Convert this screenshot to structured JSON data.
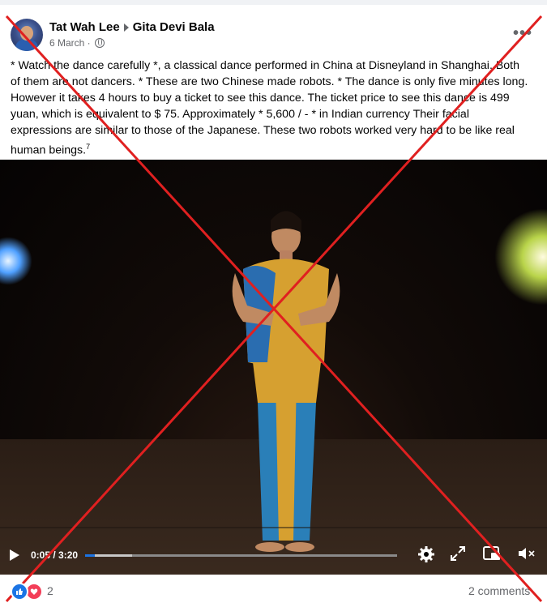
{
  "post": {
    "author": "Tat Wah Lee",
    "target": "Gita Devi Bala",
    "date": "6 March ·",
    "more_label": "•••",
    "text": "* Watch the dance carefully *, a classical dance performed in China at Disneyland in Shanghai. Both of them are not dancers. * These are two Chinese made robots. * The dance is only five minutes long. However it takes 4 hours to buy a ticket to see this dance. The ticket price to see this dance is 499 yuan, which is equivalent to $ 75. Approximately * 5,600 / - * in Indian currency Their facial expressions are similar to those of the Japanese. These two robots worked very hard to be like real human beings.",
    "footnote": "7"
  },
  "video": {
    "time": "0:05 / 3:20",
    "progress": 0.03,
    "buffered": 0.15
  },
  "footer": {
    "reaction_count": "2",
    "comments": "2 comments"
  },
  "icons": {
    "privacy": "globe-icon",
    "play": "play-icon",
    "settings": "gear-icon",
    "fullscreen": "expand-icon",
    "pip": "picture-in-picture-icon",
    "volume": "muted-speaker-icon",
    "like": "like-icon",
    "love": "love-icon"
  },
  "colors": {
    "accent": "#1b74e4",
    "love": "#f33e58",
    "fact_check_cross": "#e02020"
  }
}
